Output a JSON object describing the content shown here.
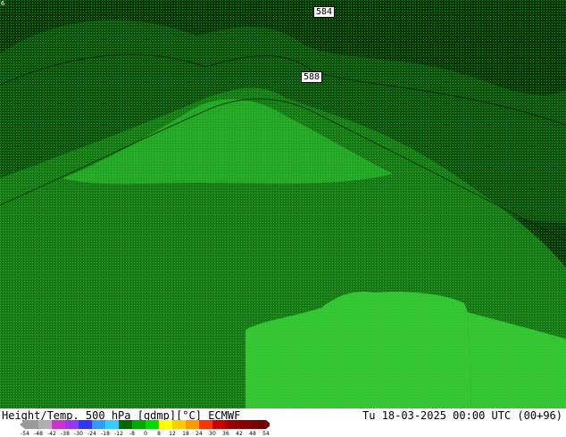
{
  "map": {
    "contour_labels": [
      "584",
      "588"
    ],
    "corner_label": "6",
    "colors": {
      "darkest": "#093709",
      "dark": "#0f520f",
      "mid": "#187818",
      "light": "#25a525",
      "brightest": "#34c434",
      "pattern": "#2ee02e"
    }
  },
  "footer": {
    "title": "Height/Temp. 500 hPa [gdmp][°C] ECMWF",
    "datetime": "Tu 18-03-2025 00:00 UTC (00+96)"
  },
  "legend": {
    "ticks": [
      "-54",
      "-48",
      "-42",
      "-38",
      "-30",
      "-24",
      "-18",
      "-12",
      "-8",
      "0",
      "8",
      "12",
      "18",
      "24",
      "30",
      "36",
      "42",
      "48",
      "54"
    ],
    "colors": [
      "#9a9a9a",
      "#b0b0b0",
      "#cc33cc",
      "#9933ff",
      "#3333ff",
      "#3399ff",
      "#33ccff",
      "#006600",
      "#00aa00",
      "#00dd00",
      "#ffff00",
      "#ffcc00",
      "#ff9900",
      "#ff3300",
      "#cc0000",
      "#990000",
      "#880000",
      "#770000"
    ]
  }
}
